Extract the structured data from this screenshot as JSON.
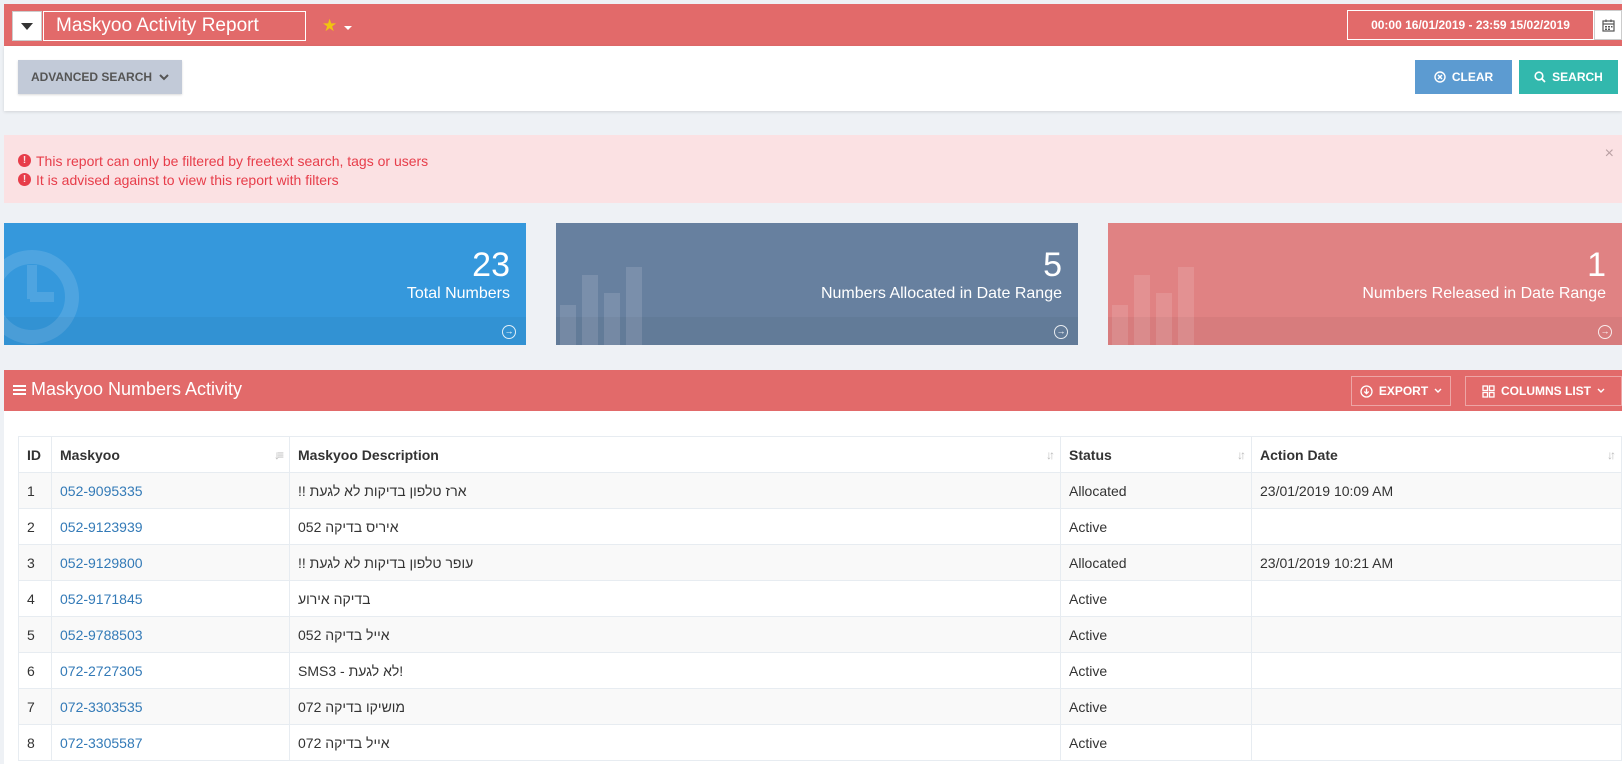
{
  "header": {
    "report_title": "Maskyoo Activity Report",
    "date_range": "00:00 16/01/2019 -  23:59 15/02/2019"
  },
  "search": {
    "advanced_label": "ADVANCED SEARCH",
    "clear_label": "CLEAR",
    "search_label": "SEARCH"
  },
  "alert": {
    "line1": "This report can only be filtered by freetext search, tags or users",
    "line2": "It is advised against to view this report with filters",
    "close": "×"
  },
  "stats": [
    {
      "value": "23",
      "label": "Total Numbers"
    },
    {
      "value": "5",
      "label": "Numbers Allocated in Date Range"
    },
    {
      "value": "1",
      "label": "Numbers Released in Date Range"
    }
  ],
  "table": {
    "title": "Maskyoo Numbers Activity",
    "export_label": "EXPORT",
    "columns_label": "COLUMNS LIST",
    "headers": [
      "ID",
      "Maskyoo",
      "Maskyoo Description",
      "Status",
      "Action Date"
    ],
    "rows": [
      {
        "id": "1",
        "maskyoo": "052-9095335",
        "description": "ארז טלפון בדיקות לא לגעת !!",
        "status": "Allocated",
        "date": "23/01/2019 10:09 AM"
      },
      {
        "id": "2",
        "maskyoo": "052-9123939",
        "description": "איריס בדיקה 052",
        "status": "Active",
        "date": ""
      },
      {
        "id": "3",
        "maskyoo": "052-9129800",
        "description": "עופר טלפון בדיקות לא לגעת !!",
        "status": "Allocated",
        "date": "23/01/2019 10:21 AM"
      },
      {
        "id": "4",
        "maskyoo": "052-9171845",
        "description": "בדיקה אירוע",
        "status": "Active",
        "date": ""
      },
      {
        "id": "5",
        "maskyoo": "052-9788503",
        "description": "אייל בדיקה 052",
        "status": "Active",
        "date": ""
      },
      {
        "id": "6",
        "maskyoo": "072-2727305",
        "description": "SMS3 - לא לגעת!",
        "status": "Active",
        "date": ""
      },
      {
        "id": "7",
        "maskyoo": "072-3303535",
        "description": "מושיקו בדיקה 072",
        "status": "Active",
        "date": ""
      },
      {
        "id": "8",
        "maskyoo": "072-3305587",
        "description": "אייל בדיקה 072",
        "status": "Active",
        "date": ""
      }
    ]
  },
  "colors": {
    "header_red": "#e26a6a",
    "stat_blue": "#3598dc",
    "stat_slate": "#67809f",
    "stat_red": "#e08283",
    "clear_blue": "#5c9bd1",
    "search_teal": "#32b8ad",
    "alert_bg": "#fbe1e3",
    "alert_text": "#e73d4a",
    "link": "#337ab7"
  }
}
